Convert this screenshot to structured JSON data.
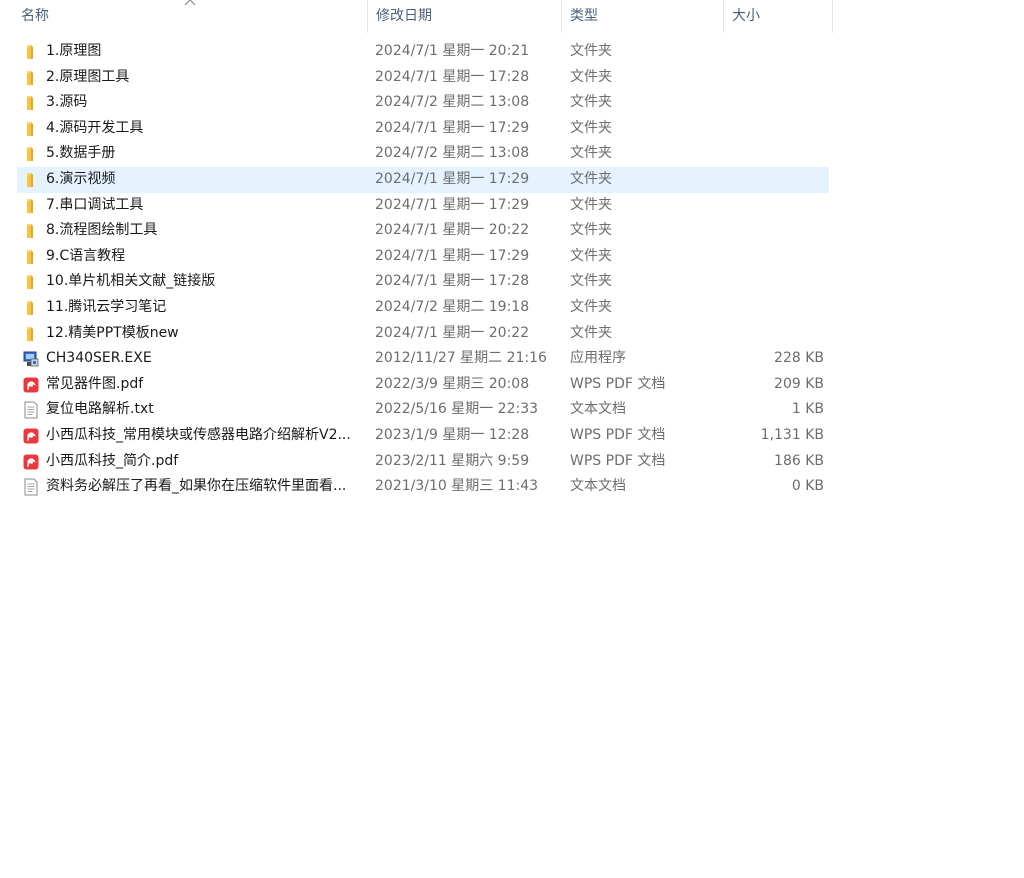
{
  "columns": {
    "name": "名称",
    "date": "修改日期",
    "type": "类型",
    "size": "大小"
  },
  "files": [
    {
      "icon": "folder-icon",
      "name": "1.原理图",
      "date": "2024/7/1 星期一 20:21",
      "type": "文件夹",
      "size": ""
    },
    {
      "icon": "folder-icon",
      "name": "2.原理图工具",
      "date": "2024/7/1 星期一 17:28",
      "type": "文件夹",
      "size": ""
    },
    {
      "icon": "folder-icon",
      "name": "3.源码",
      "date": "2024/7/2 星期二 13:08",
      "type": "文件夹",
      "size": ""
    },
    {
      "icon": "folder-icon",
      "name": "4.源码开发工具",
      "date": "2024/7/1 星期一 17:29",
      "type": "文件夹",
      "size": ""
    },
    {
      "icon": "folder-icon",
      "name": "5.数据手册",
      "date": "2024/7/2 星期二 13:08",
      "type": "文件夹",
      "size": ""
    },
    {
      "icon": "folder-icon",
      "name": "6.演示视频",
      "date": "2024/7/1 星期一 17:29",
      "type": "文件夹",
      "size": "",
      "selected": true
    },
    {
      "icon": "folder-icon",
      "name": "7.串口调试工具",
      "date": "2024/7/1 星期一 17:29",
      "type": "文件夹",
      "size": ""
    },
    {
      "icon": "folder-icon",
      "name": "8.流程图绘制工具",
      "date": "2024/7/1 星期一 20:22",
      "type": "文件夹",
      "size": ""
    },
    {
      "icon": "folder-icon",
      "name": "9.C语言教程",
      "date": "2024/7/1 星期一 17:29",
      "type": "文件夹",
      "size": ""
    },
    {
      "icon": "folder-icon",
      "name": "10.单片机相关文献_链接版",
      "date": "2024/7/1 星期一 17:28",
      "type": "文件夹",
      "size": ""
    },
    {
      "icon": "folder-icon",
      "name": "11.腾讯云学习笔记",
      "date": "2024/7/2 星期二 19:18",
      "type": "文件夹",
      "size": ""
    },
    {
      "icon": "folder-icon",
      "name": "12.精美PPT模板new",
      "date": "2024/7/1 星期一 20:22",
      "type": "文件夹",
      "size": ""
    },
    {
      "icon": "exe-icon",
      "name": "CH340SER.EXE",
      "date": "2012/11/27 星期二 21:16",
      "type": "应用程序",
      "size": "228 KB"
    },
    {
      "icon": "pdf-icon",
      "name": "常见器件图.pdf",
      "date": "2022/3/9 星期三 20:08",
      "type": "WPS PDF 文档",
      "size": "209 KB"
    },
    {
      "icon": "txt-icon",
      "name": "复位电路解析.txt",
      "date": "2022/5/16 星期一 22:33",
      "type": "文本文档",
      "size": "1 KB"
    },
    {
      "icon": "pdf-icon",
      "name": "小西瓜科技_常用模块或传感器电路介绍解析V2...",
      "date": "2023/1/9 星期一 12:28",
      "type": "WPS PDF 文档",
      "size": "1,131 KB"
    },
    {
      "icon": "pdf-icon",
      "name": "小西瓜科技_简介.pdf",
      "date": "2023/2/11 星期六 9:59",
      "type": "WPS PDF 文档",
      "size": "186 KB"
    },
    {
      "icon": "txt-icon",
      "name": "资料务必解压了再看_如果你在压缩软件里面看...",
      "date": "2021/3/10 星期三 11:43",
      "type": "文本文档",
      "size": "0 KB"
    }
  ]
}
